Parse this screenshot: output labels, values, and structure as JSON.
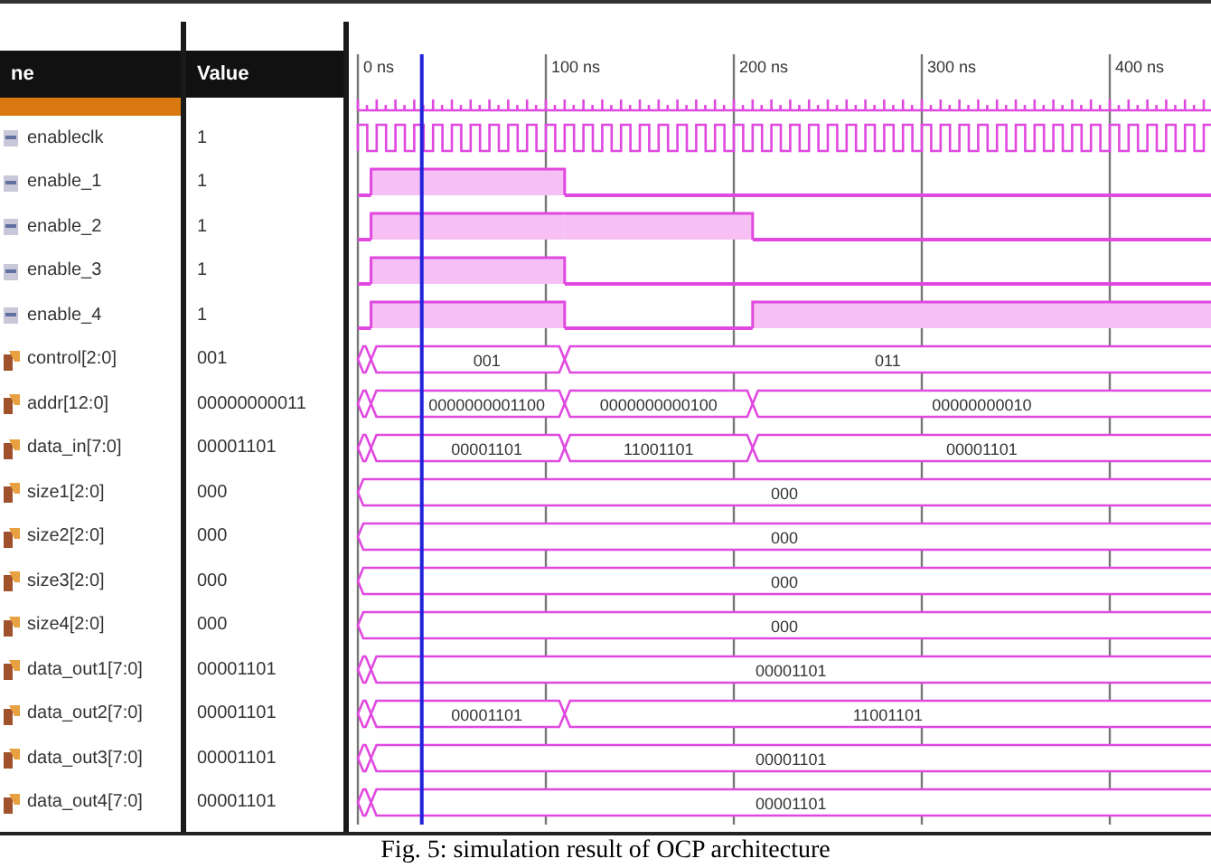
{
  "columns": [
    {
      "label": "ne"
    },
    {
      "label": "Value"
    }
  ],
  "ruler": {
    "labels": [
      "0 ns",
      "100 ns",
      "200 ns",
      "300 ns",
      "400 ns"
    ]
  },
  "signals": [
    {
      "name": "enableclk",
      "value": "1",
      "kind": "clock"
    },
    {
      "name": "enable_1",
      "value": "1",
      "kind": "bit",
      "segments": [
        {
          "high": false
        },
        {
          "high": true
        },
        {
          "high": false
        }
      ]
    },
    {
      "name": "enable_2",
      "value": "1",
      "kind": "bit",
      "segments": [
        {
          "high": false
        },
        {
          "high": true
        },
        {
          "high": true
        },
        {
          "high": false
        }
      ]
    },
    {
      "name": "enable_3",
      "value": "1",
      "kind": "bit",
      "segments": [
        {
          "high": false
        },
        {
          "high": true
        },
        {
          "high": false
        }
      ]
    },
    {
      "name": "enable_4",
      "value": "1",
      "kind": "bit",
      "segments": [
        {
          "high": false
        },
        {
          "high": true
        },
        {
          "high": false
        },
        {
          "high": true
        }
      ]
    },
    {
      "name": "control[2:0]",
      "value": "001",
      "kind": "bus",
      "segments": [
        {
          "kind": "unknown"
        },
        {
          "kind": "value",
          "value": "001"
        },
        {
          "kind": "value",
          "value": "011"
        }
      ]
    },
    {
      "name": "addr[12:0]",
      "value": "00000000011",
      "kind": "bus",
      "segments": [
        {
          "kind": "unknown"
        },
        {
          "kind": "value",
          "value": "0000000001100"
        },
        {
          "kind": "value",
          "value": "0000000000100"
        },
        {
          "kind": "value",
          "value": "00000000010"
        }
      ]
    },
    {
      "name": "data_in[7:0]",
      "value": "00001101",
      "kind": "bus",
      "segments": [
        {
          "kind": "unknown"
        },
        {
          "kind": "value",
          "value": "00001101"
        },
        {
          "kind": "value",
          "value": "11001101"
        },
        {
          "kind": "value",
          "value": "00001101"
        }
      ]
    },
    {
      "name": "size1[2:0]",
      "value": "000",
      "kind": "bus",
      "segments": [
        {
          "kind": "value",
          "value": "000"
        }
      ]
    },
    {
      "name": "size2[2:0]",
      "value": "000",
      "kind": "bus",
      "segments": [
        {
          "kind": "value",
          "value": "000"
        }
      ]
    },
    {
      "name": "size3[2:0]",
      "value": "000",
      "kind": "bus",
      "segments": [
        {
          "kind": "value",
          "value": "000"
        }
      ]
    },
    {
      "name": "size4[2:0]",
      "value": "000",
      "kind": "bus",
      "segments": [
        {
          "kind": "value",
          "value": "000"
        }
      ]
    },
    {
      "name": "data_out1[7:0]",
      "value": "00001101",
      "kind": "bus",
      "segments": [
        {
          "kind": "unknown"
        },
        {
          "kind": "value",
          "value": "00001101"
        }
      ]
    },
    {
      "name": "data_out2[7:0]",
      "value": "00001101",
      "kind": "bus",
      "segments": [
        {
          "kind": "unknown"
        },
        {
          "kind": "value",
          "value": "00001101"
        },
        {
          "kind": "value",
          "value": "11001101"
        }
      ]
    },
    {
      "name": "data_out3[7:0]",
      "value": "00001101",
      "kind": "bus",
      "segments": [
        {
          "kind": "unknown"
        },
        {
          "kind": "value",
          "value": "00001101"
        }
      ]
    },
    {
      "name": "data_out4[7:0]",
      "value": "00001101",
      "kind": "bus",
      "segments": [
        {
          "kind": "unknown"
        },
        {
          "kind": "value",
          "value": "00001101"
        }
      ]
    }
  ],
  "caption": "Fig. 5: simulation result of OCP architecture"
}
